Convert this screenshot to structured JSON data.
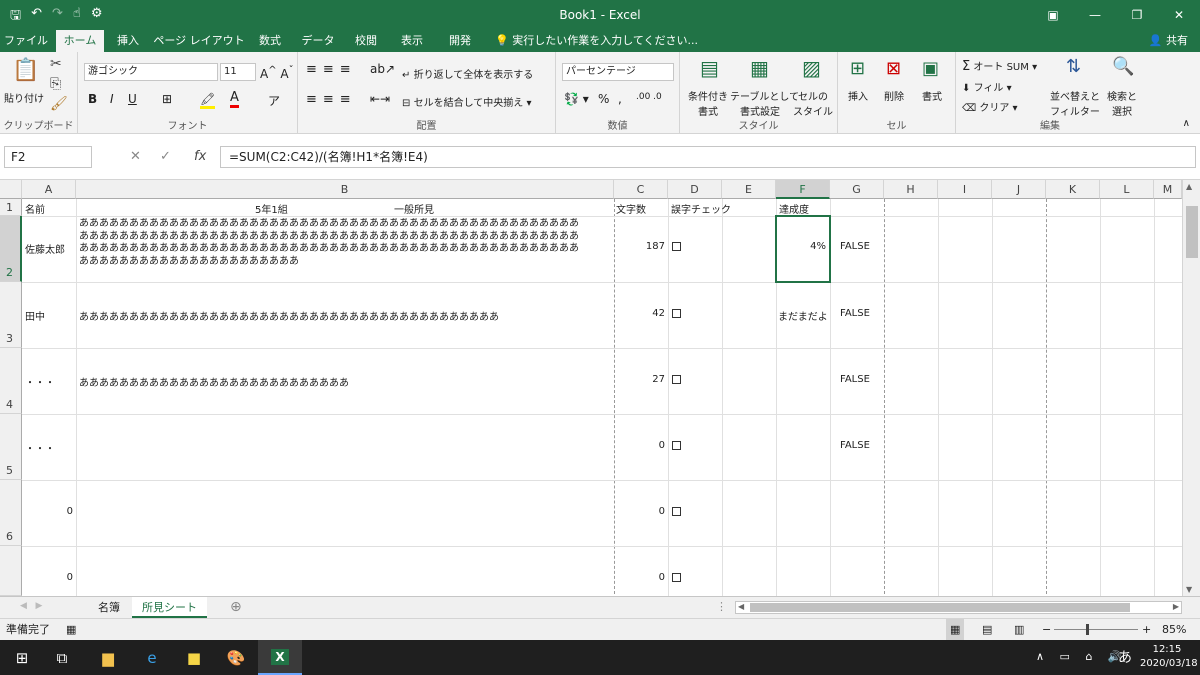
{
  "window": {
    "title": "Book1 - Excel"
  },
  "tabs": [
    "ファイル",
    "ホーム",
    "挿入",
    "ページ レイアウト",
    "数式",
    "データ",
    "校閲",
    "表示",
    "開発"
  ],
  "tell_me": "実行したい作業を入力してください...",
  "share": "共有",
  "ribbon": {
    "paste": "貼り付け",
    "clipboard": "クリップボード",
    "font_name": "游ゴシック",
    "font_size": "11",
    "font_group": "フォント",
    "wrap_text": "折り返して全体を表示する",
    "merge_center": "セルを結合して中央揃え",
    "alignment": "配置",
    "number_format": "パーセンテージ",
    "number": "数値",
    "cond_format_1": "条件付き",
    "cond_format_2": "書式",
    "table_format_1": "テーブルとして",
    "table_format_2": "書式設定",
    "cell_style_1": "セルの",
    "cell_style_2": "スタイル",
    "style": "スタイル",
    "insert": "挿入",
    "delete": "削除",
    "format": "書式",
    "cells": "セル",
    "autosum": "オート SUM",
    "fill": "フィル",
    "clear": "クリア",
    "sort_1": "並べ替えと",
    "sort_2": "フィルター",
    "find_1": "検索と",
    "find_2": "選択",
    "editing": "編集"
  },
  "formula": {
    "name_box": "F2",
    "content": "=SUM(C2:C42)/(名簿!H1*名簿!E4)"
  },
  "columns": [
    "A",
    "B",
    "C",
    "D",
    "E",
    "F",
    "G",
    "H",
    "I",
    "J",
    "K",
    "L",
    "M"
  ],
  "rows": [
    "1",
    "2",
    "3",
    "4",
    "5",
    "6"
  ],
  "header_row": {
    "a": "名前",
    "b1": "5年1組",
    "b2": "一般所見",
    "c": "文字数",
    "d": "誤字チェック",
    "f": "達成度"
  },
  "data_rows": [
    {
      "a": "佐藤太郎",
      "b_lines": [
        "ああああああああああああああああああああああああああああああああああああああああああああああああああ",
        "ああああああああああああああああああああああああああああああああああああああああああああああああああ",
        "ああああああああああああああああああああああああああああああああああああああああああああああああああ",
        "ああああああああああああああああああああああ"
      ],
      "c": "187",
      "f": "4%",
      "g": "FALSE"
    },
    {
      "a": "田中",
      "b_lines": [
        "ああああああああああああああああああああああああああああああああああああああああああ"
      ],
      "c": "42",
      "f": "まだまだよ",
      "g": "FALSE"
    },
    {
      "a": "・・・",
      "b_lines": [
        "あああああああああああああああああああああああああああ"
      ],
      "c": "27",
      "f": "",
      "g": "FALSE"
    },
    {
      "a": "・・・",
      "b_lines": [],
      "c": "0",
      "f": "",
      "g": "FALSE"
    },
    {
      "a": "0",
      "b_lines": [],
      "c": "0",
      "f": "",
      "g": ""
    },
    {
      "a": "0",
      "b_lines": [],
      "c": "0",
      "f": "",
      "g": ""
    }
  ],
  "sheets": [
    "名簿",
    "所見シート"
  ],
  "status": {
    "ready": "準備完了",
    "zoom": "85%"
  },
  "clock": {
    "time": "12:15",
    "date": "2020/03/18"
  },
  "ime": "あ"
}
